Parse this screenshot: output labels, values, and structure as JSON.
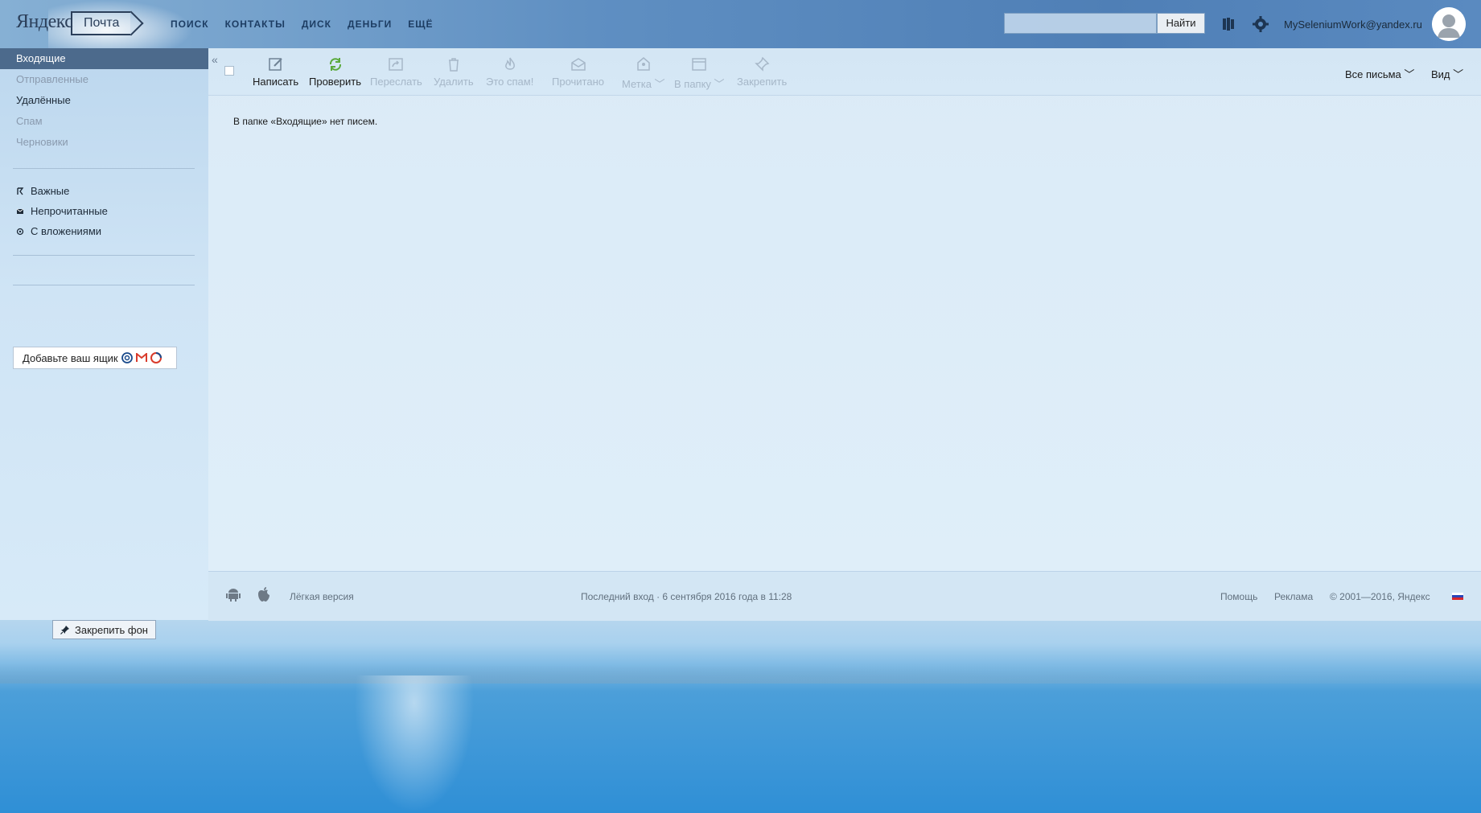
{
  "header": {
    "logo_brand": "Яндекс",
    "logo_service": "Почта",
    "nav": [
      "ПОИСК",
      "КОНТАКТЫ",
      "ДИСК",
      "ДЕНЬГИ",
      "ЕЩЁ"
    ],
    "search_placeholder": "",
    "search_button": "Найти",
    "user_email": "MySeleniumWork@yandex.ru"
  },
  "sidebar": {
    "folders": [
      "Входящие",
      "Отправленные",
      "Удалённые",
      "Спам",
      "Черновики"
    ],
    "filters": [
      "Важные",
      "Непрочитанные",
      "С вложениями"
    ],
    "add_mailbox": "Добавьте ваш ящик",
    "pin_background": "Закрепить фон"
  },
  "toolbar": {
    "buttons": [
      "Написать",
      "Проверить",
      "Переслать",
      "Удалить",
      "Это спам!",
      "Прочитано",
      "Метка",
      "В папку",
      "Закрепить"
    ],
    "all_letters": "Все письма",
    "view": "Вид"
  },
  "main": {
    "empty_message": "В папке «Входящие» нет писем."
  },
  "footer": {
    "light_version": "Лёгкая версия",
    "last_login": "Последний вход · 6 сентября 2016 года в 11:28",
    "help": "Помощь",
    "ads": "Реклама",
    "copyright": "© 2001—2016, Яндекс"
  },
  "colors": {
    "active_folder_bg": "#4c6a8c",
    "refresh_icon": "#5aaa3c",
    "muted_text": "#a6b7c8"
  }
}
